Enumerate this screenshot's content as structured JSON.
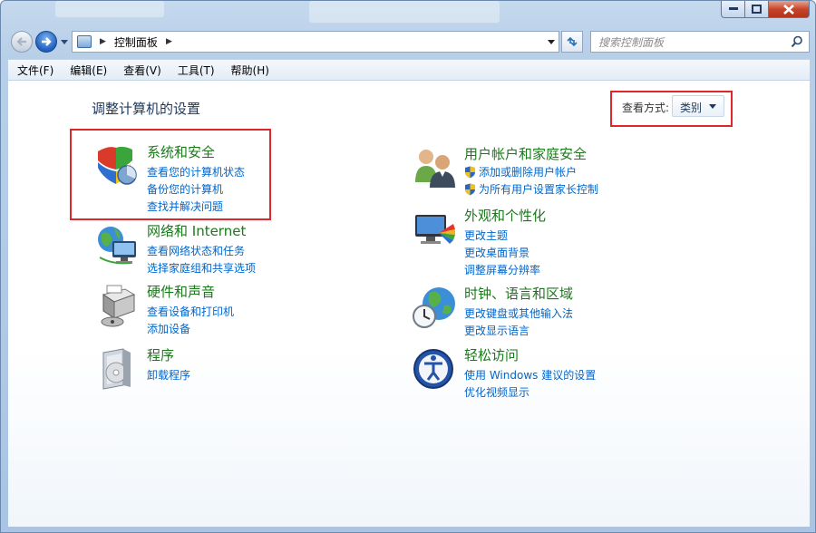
{
  "window": {
    "title": "控制面板"
  },
  "address": {
    "breadcrumb": "控制面板",
    "search_placeholder": "搜索控制面板"
  },
  "menu": [
    "文件(F)",
    "编辑(E)",
    "查看(V)",
    "工具(T)",
    "帮助(H)"
  ],
  "heading": "调整计算机的设置",
  "view_by": {
    "label": "查看方式:",
    "value": "类别"
  },
  "categories_left": [
    {
      "title": "系统和安全",
      "icon": "system-security-icon",
      "links": [
        "查看您的计算机状态",
        "备份您的计算机",
        "查找并解决问题"
      ]
    },
    {
      "title": "网络和 Internet",
      "icon": "network-internet-icon",
      "links": [
        "查看网络状态和任务",
        "选择家庭组和共享选项"
      ]
    },
    {
      "title": "硬件和声音",
      "icon": "hardware-sound-icon",
      "links": [
        "查看设备和打印机",
        "添加设备"
      ]
    },
    {
      "title": "程序",
      "icon": "programs-icon",
      "links": [
        "卸载程序"
      ]
    }
  ],
  "categories_right": [
    {
      "title": "用户帐户和家庭安全",
      "icon": "user-accounts-icon",
      "links": [
        "添加或删除用户帐户",
        "为所有用户设置家长控制"
      ]
    },
    {
      "title": "外观和个性化",
      "icon": "appearance-icon",
      "links": [
        "更改主题",
        "更改桌面背景",
        "调整屏幕分辨率"
      ]
    },
    {
      "title": "时钟、语言和区域",
      "icon": "clock-language-region-icon",
      "links": [
        "更改键盘或其他输入法",
        "更改显示语言"
      ]
    },
    {
      "title": "轻松访问",
      "icon": "ease-of-access-icon",
      "links": [
        "使用 Windows 建议的设置",
        "优化视频显示"
      ]
    }
  ],
  "colors": {
    "category_title": "#1a7a1a",
    "link": "#0066cc",
    "highlight_box": "#e0262d"
  }
}
